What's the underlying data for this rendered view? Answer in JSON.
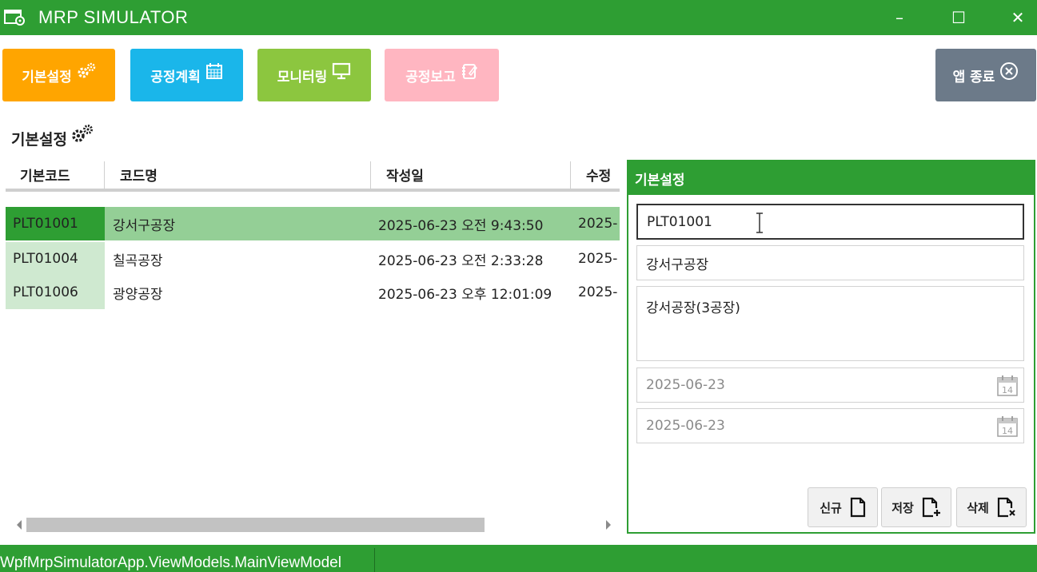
{
  "window": {
    "title": "MRP SIMULATOR",
    "minimize": "–",
    "maximize": "☐",
    "close": "✕"
  },
  "toolbar": {
    "basic_settings": {
      "label": "기본설정",
      "color": "#ffa500"
    },
    "process_plan": {
      "label": "공정계획",
      "color": "#1ab6ea"
    },
    "monitoring": {
      "label": "모니터링",
      "color": "#8cc63f"
    },
    "process_report": {
      "label": "공정보고",
      "color": "#ffb6c1"
    },
    "exit_app": {
      "label": "앱 종료",
      "color": "#6c7a89"
    }
  },
  "page": {
    "section_title": "기본설정"
  },
  "grid": {
    "columns": [
      "기본코드",
      "코드명",
      "작성일",
      "수정"
    ],
    "rows": [
      {
        "code": "PLT01001",
        "name": "강서구공장",
        "created": "2025-06-23 오전 9:43:50",
        "modified": "2025-"
      },
      {
        "code": "PLT01004",
        "name": "칠곡공장",
        "created": "2025-06-23 오전 2:33:28",
        "modified": "2025-"
      },
      {
        "code": "PLT01006",
        "name": "광양공장",
        "created": "2025-06-23 오후 12:01:09",
        "modified": "2025-"
      }
    ],
    "selected_index": 0
  },
  "detail_panel": {
    "title": "기본설정",
    "code_value": "PLT01001",
    "name_value": "강서구공장",
    "description_value": "강서공장(3공장)",
    "created_date": "2025-06-23",
    "modified_date": "2025-06-23",
    "calendar_day": "14",
    "buttons": {
      "new": "신규",
      "save": "저장",
      "delete": "삭제"
    }
  },
  "statusbar": {
    "text": "WpfMrpSimulatorApp.ViewModels.MainViewModel"
  },
  "colors": {
    "accent": "#2e9e33",
    "selected_row": "#94cf96",
    "selected_row_code": "#2e9e33",
    "code_cell": "#cfe9d0"
  }
}
